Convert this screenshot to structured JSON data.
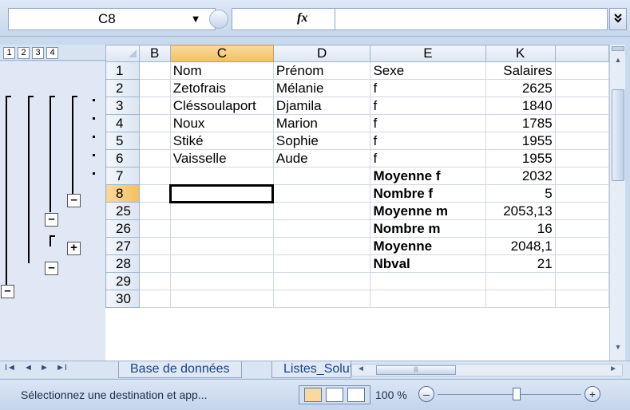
{
  "formula_bar": {
    "name_box": "C8",
    "dropdown_icon": "chevron-down-icon",
    "fx_label": "fx",
    "formula_value": ""
  },
  "outline": {
    "levels": [
      "1",
      "2",
      "3",
      "4"
    ],
    "collapse_symbol": "–",
    "expand_symbol": "+"
  },
  "grid": {
    "columns": [
      "B",
      "C",
      "D",
      "E",
      "K"
    ],
    "selected_column": "C",
    "rows": [
      {
        "row": "1",
        "B": "",
        "C": "Nom",
        "D": "Prénom",
        "E": "Sexe",
        "K": "Salaires",
        "E_bold": false
      },
      {
        "row": "2",
        "B": "",
        "C": "Zetofrais",
        "D": "Mélanie",
        "E": "f",
        "K": "2625",
        "E_bold": false
      },
      {
        "row": "3",
        "B": "",
        "C": "Cléssoulaport",
        "D": "Djamila",
        "E": "f",
        "K": "1840",
        "E_bold": false
      },
      {
        "row": "4",
        "B": "",
        "C": "Noux",
        "D": "Marion",
        "E": "f",
        "K": "1785",
        "E_bold": false
      },
      {
        "row": "5",
        "B": "",
        "C": "Stiké",
        "D": "Sophie",
        "E": "f",
        "K": "1955",
        "E_bold": false
      },
      {
        "row": "6",
        "B": "",
        "C": "Vaisselle",
        "D": "Aude",
        "E": "f",
        "K": "1955",
        "E_bold": false
      },
      {
        "row": "7",
        "B": "",
        "C": "",
        "D": "",
        "E": "Moyenne f",
        "K": "2032",
        "E_bold": true
      },
      {
        "row": "8",
        "B": "",
        "C": "",
        "D": "",
        "E": "Nombre f",
        "K": "5",
        "E_bold": true
      },
      {
        "row": "25",
        "B": "",
        "C": "",
        "D": "",
        "E": "Moyenne m",
        "K": "2053,13",
        "E_bold": true
      },
      {
        "row": "26",
        "B": "",
        "C": "",
        "D": "",
        "E": "Nombre m",
        "K": "16",
        "E_bold": true
      },
      {
        "row": "27",
        "B": "",
        "C": "",
        "D": "",
        "E": "Moyenne",
        "K": "2048,1",
        "E_bold": true
      },
      {
        "row": "28",
        "B": "",
        "C": "",
        "D": "",
        "E": "Nbval",
        "K": "21",
        "E_bold": true
      },
      {
        "row": "29",
        "B": "",
        "C": "",
        "D": "",
        "E": "",
        "K": "",
        "E_bold": false
      },
      {
        "row": "30",
        "B": "",
        "C": "",
        "D": "",
        "E": "",
        "K": "",
        "E_bold": false
      }
    ],
    "active_cell": "C8"
  },
  "tabs": {
    "nav_first": "◄",
    "items": [
      "Base de données",
      "Listes_Soluti"
    ]
  },
  "status": {
    "message": "Sélectionnez une destination et app...",
    "zoom": "100 %",
    "zoom_minus": "–",
    "zoom_plus": "+"
  }
}
